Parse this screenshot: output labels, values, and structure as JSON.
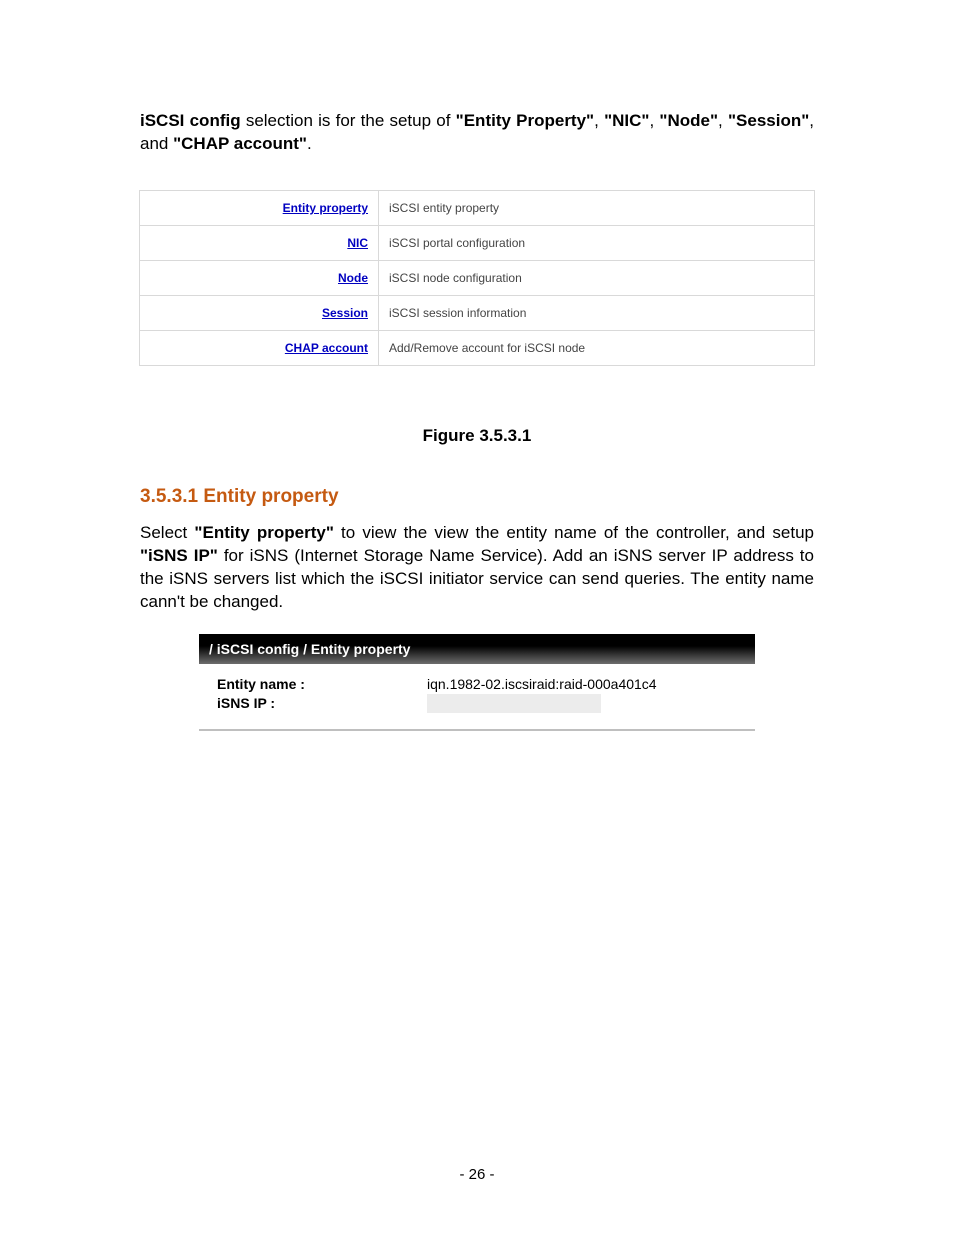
{
  "intro": {
    "prefix_bold": "iSCSI config",
    "text1": " selection is for the setup of ",
    "b1": "\"Entity Property\"",
    "sep1": ", ",
    "b2": "\"NIC\"",
    "sep2": ", ",
    "b3": "\"Node\"",
    "sep3": ", ",
    "b4": "\"Session\"",
    "sep4": ", and ",
    "b5": "\"CHAP account\"",
    "period": "."
  },
  "config_table": [
    {
      "link": "Entity property",
      "desc": "iSCSI entity property"
    },
    {
      "link": "NIC",
      "desc": "iSCSI portal configuration"
    },
    {
      "link": "Node",
      "desc": "iSCSI node configuration"
    },
    {
      "link": "Session",
      "desc": "iSCSI session information"
    },
    {
      "link": "CHAP account",
      "desc": "Add/Remove account for iSCSI node"
    }
  ],
  "figure_caption": "Figure 3.5.3.1",
  "section_sub": "3.5.3.1   Entity property",
  "body": {
    "t1": "Select ",
    "q1": "\"Entity property\"",
    "t2": " to view the view the entity name of the controller, and setup ",
    "q2": "\"iSNS IP\"",
    "t3": " for iSNS (Internet Storage Name Service). Add an iSNS server IP address to the iSNS servers list which the iSCSI initiator service can send queries. The entity name cann't be changed."
  },
  "panel": {
    "breadcrumb": "/ iSCSI config / Entity property",
    "rows": {
      "entity_label": "Entity name :",
      "entity_value": "iqn.1982-02.iscsiraid:raid-000a401c4",
      "isns_label": "iSNS IP :",
      "isns_value": ""
    }
  },
  "page_number": "- 26 -"
}
